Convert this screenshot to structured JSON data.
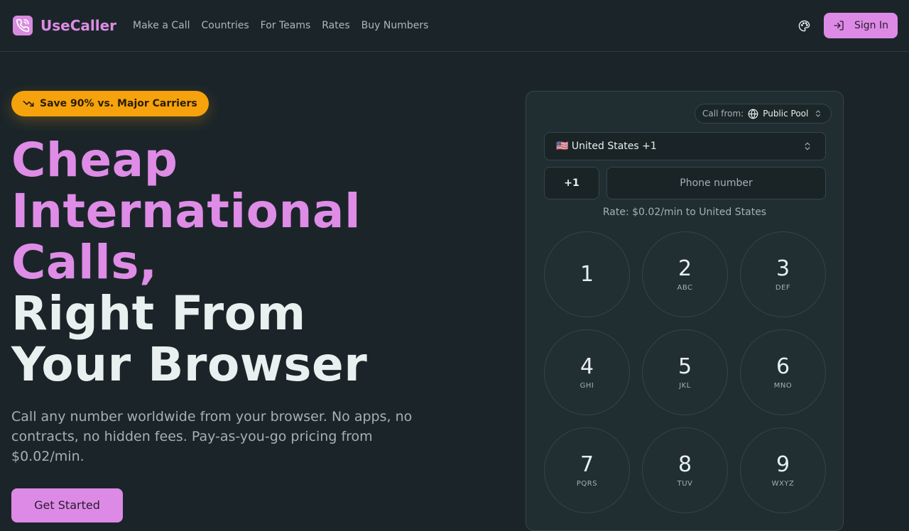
{
  "header": {
    "brand": "UseCaller",
    "nav": [
      "Make a Call",
      "Countries",
      "For Teams",
      "Rates",
      "Buy Numbers"
    ],
    "sign_in_label": "Sign In"
  },
  "hero": {
    "badge": "Save 90% vs. Major Carriers",
    "headline_pink": [
      "Cheap",
      "International",
      "Calls,"
    ],
    "headline_white": [
      "Right From",
      "Your Browser"
    ],
    "subtitle": "Call any number worldwide from your browser. No apps, no contracts, no hidden fees. Pay-as-you-go pricing from $0.02/min.",
    "cta_label": "Get Started"
  },
  "dialer": {
    "call_from_label": "Call from:",
    "call_from_value": "Public Pool",
    "country_value": "🇺🇸 United States +1",
    "dial_code": "+1",
    "phone_placeholder": "Phone number",
    "rate_text": "Rate: $0.02/min to United States",
    "keys": [
      {
        "digit": "1",
        "letters": ""
      },
      {
        "digit": "2",
        "letters": "ABC"
      },
      {
        "digit": "3",
        "letters": "DEF"
      },
      {
        "digit": "4",
        "letters": "GHI"
      },
      {
        "digit": "5",
        "letters": "JKL"
      },
      {
        "digit": "6",
        "letters": "MNO"
      },
      {
        "digit": "7",
        "letters": "PQRS"
      },
      {
        "digit": "8",
        "letters": "TUV"
      },
      {
        "digit": "9",
        "letters": "WXYZ"
      }
    ]
  },
  "icons": {
    "logo": "phone-icon",
    "theme": "palette-icon",
    "sign_in": "login-icon",
    "badge": "trending-down-icon",
    "call_from": "globe-icon",
    "selector": "chevron-up-down-icon"
  },
  "colors": {
    "background": "#1b2529",
    "accent": "#de8ce6",
    "badge": "#f6a20c"
  }
}
